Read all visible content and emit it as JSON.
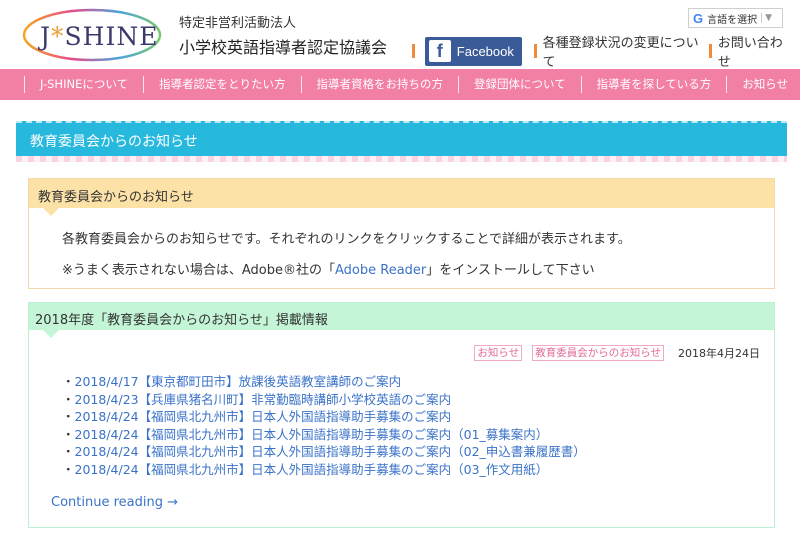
{
  "header": {
    "logo_text_left": "J",
    "logo_star": "*",
    "logo_text_right": "SHINE",
    "org_sub": "特定非営利活動法人",
    "org_name": "小学校英語指導者認定協議会",
    "translate_label": "言語を選択",
    "translate_arrow": "▼",
    "facebook_label": "Facebook",
    "links": [
      "各種登録状況の変更について",
      "お問い合わせ"
    ]
  },
  "nav": [
    "J-SHINEについて",
    "指導者認定をとりたい方",
    "指導者資格をお持ちの方",
    "登録団体について",
    "指導者を探している方",
    "お知らせ"
  ],
  "page_title": "教育委員会からのお知らせ",
  "notice": {
    "heading": "教育委員会からのお知らせ",
    "text1": "各教育委員会からのお知らせです。それぞれのリンクをクリックすることで詳細が表示されます。",
    "text2_pre": "※うまく表示されない場合は、Adobe®社の「",
    "text2_link": "Adobe Reader",
    "text2_post": "」をインストールして下さい"
  },
  "post": {
    "heading": "2018年度「教育委員会からのお知らせ」掲載情報",
    "tags": [
      "お知らせ",
      "教育委員会からのお知らせ"
    ],
    "date": "2018年4月24日",
    "items": [
      "2018/4/17【東京都町田市】放課後英語教室講師のご案内",
      "2018/4/23【兵庫県猪名川町】非常勤臨時講師小学校英語のご案内",
      "2018/4/24【福岡県北九州市】日本人外国語指導助手募集のご案内",
      "2018/4/24【福岡県北九州市】日本人外国語指導助手募集のご案内（01_募集案内）",
      "2018/4/24【福岡県北九州市】日本人外国語指導助手募集のご案内（02_申込書兼履歴書）",
      "2018/4/24【福岡県北九州市】日本人外国語指導助手募集のご案内（03_作文用紙）"
    ],
    "continue": "Continue reading →"
  },
  "colors": {
    "nav_bg": "#f27fa4",
    "title_bg": "#26b8dd",
    "notice_head": "#fde2a8",
    "post_head": "#c4f5d6",
    "link": "#3a72c8",
    "facebook": "#3b5b98"
  }
}
